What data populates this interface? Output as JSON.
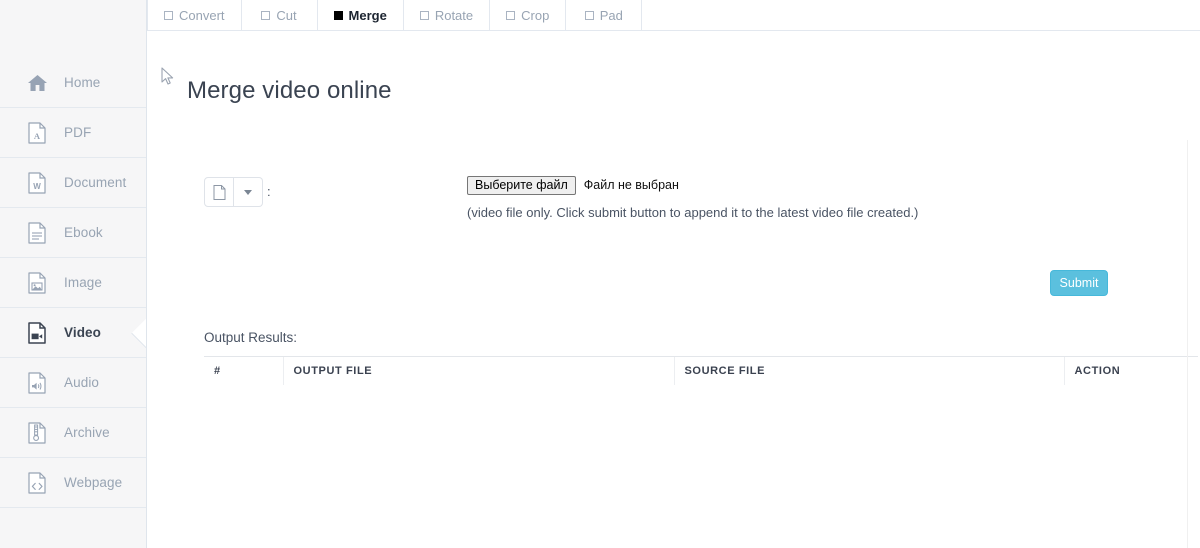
{
  "sidebar": {
    "items": [
      {
        "label": "Home",
        "icon": "home-icon",
        "active": false
      },
      {
        "label": "PDF",
        "icon": "pdf-file-icon",
        "active": false
      },
      {
        "label": "Document",
        "icon": "word-document-icon",
        "active": false
      },
      {
        "label": "Ebook",
        "icon": "ebook-file-icon",
        "active": false
      },
      {
        "label": "Image",
        "icon": "image-file-icon",
        "active": false
      },
      {
        "label": "Video",
        "icon": "video-file-icon",
        "active": true
      },
      {
        "label": "Audio",
        "icon": "audio-file-icon",
        "active": false
      },
      {
        "label": "Archive",
        "icon": "archive-file-icon",
        "active": false
      },
      {
        "label": "Webpage",
        "icon": "webpage-code-file-icon",
        "active": false
      }
    ]
  },
  "tabs": [
    {
      "label": "Convert",
      "active": false
    },
    {
      "label": "Cut",
      "active": false
    },
    {
      "label": "Merge",
      "active": true
    },
    {
      "label": "Rotate",
      "active": false
    },
    {
      "label": "Crop",
      "active": false
    },
    {
      "label": "Pad",
      "active": false
    }
  ],
  "main": {
    "title": "Merge video online",
    "source_picker": {
      "icon": "file-page-icon",
      "caret": "chevron-down-icon",
      "separator": ":"
    },
    "file_input": {
      "button_label": "Выберите файл",
      "status_text": "Файл не выбран"
    },
    "help_text": "(video file only. Click submit button to append it to the latest video file created.)",
    "submit_label": "Submit",
    "output_label": "Output Results:",
    "table": {
      "columns": [
        "#",
        "OUTPUT FILE",
        "SOURCE FILE",
        "ACTION"
      ],
      "rows": []
    }
  },
  "colors": {
    "accent": "#5bc0de",
    "sidebar_bg": "#f6f6f7",
    "muted_text": "#98a4b3",
    "active_text": "#3b4452"
  }
}
